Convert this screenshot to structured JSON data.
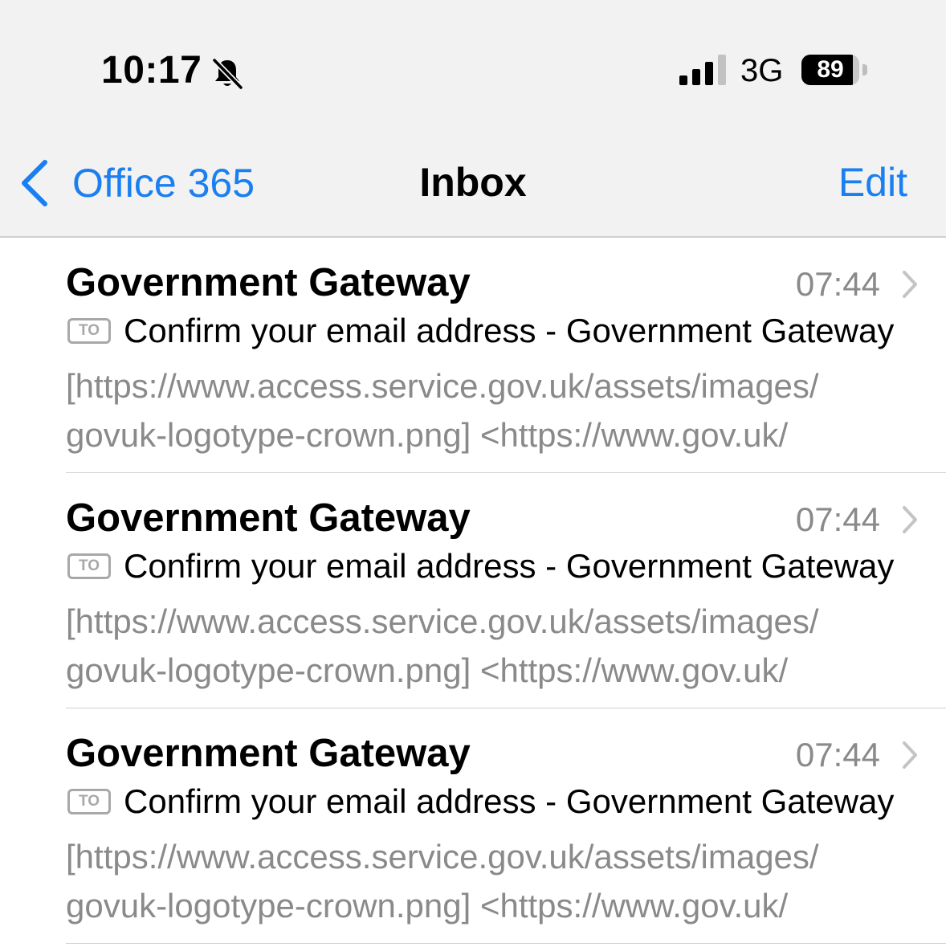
{
  "status_bar": {
    "time": "10:17",
    "silent_icon": "bell-slash-icon",
    "signal_icon": "cellular-signal-icon",
    "signal_bars": 3,
    "signal_bars_total": 4,
    "network": "3G",
    "battery_level": "89",
    "battery_fraction": 0.89
  },
  "nav": {
    "back_icon": "chevron-left-icon",
    "back_label": "Office 365",
    "title": "Inbox",
    "edit_label": "Edit"
  },
  "colors": {
    "accent": "#1a7ff0",
    "secondary_text": "#8a8a8a",
    "header_bg": "#f2f2f2"
  },
  "messages": [
    {
      "sender": "Government Gateway",
      "time": "07:44",
      "badge": "TO",
      "subject": "Confirm your email address - Government Gateway",
      "preview_line1": "[https://www.access.service.gov.uk/assets/images/",
      "preview_line2": "govuk-logotype-crown.png] <https://www.gov.uk/"
    },
    {
      "sender": "Government Gateway",
      "time": "07:44",
      "badge": "TO",
      "subject": "Confirm your email address - Government Gateway",
      "preview_line1": "[https://www.access.service.gov.uk/assets/images/",
      "preview_line2": "govuk-logotype-crown.png] <https://www.gov.uk/"
    },
    {
      "sender": "Government Gateway",
      "time": "07:44",
      "badge": "TO",
      "subject": "Confirm your email address - Government Gateway",
      "preview_line1": "[https://www.access.service.gov.uk/assets/images/",
      "preview_line2": "govuk-logotype-crown.png] <https://www.gov.uk/"
    }
  ]
}
